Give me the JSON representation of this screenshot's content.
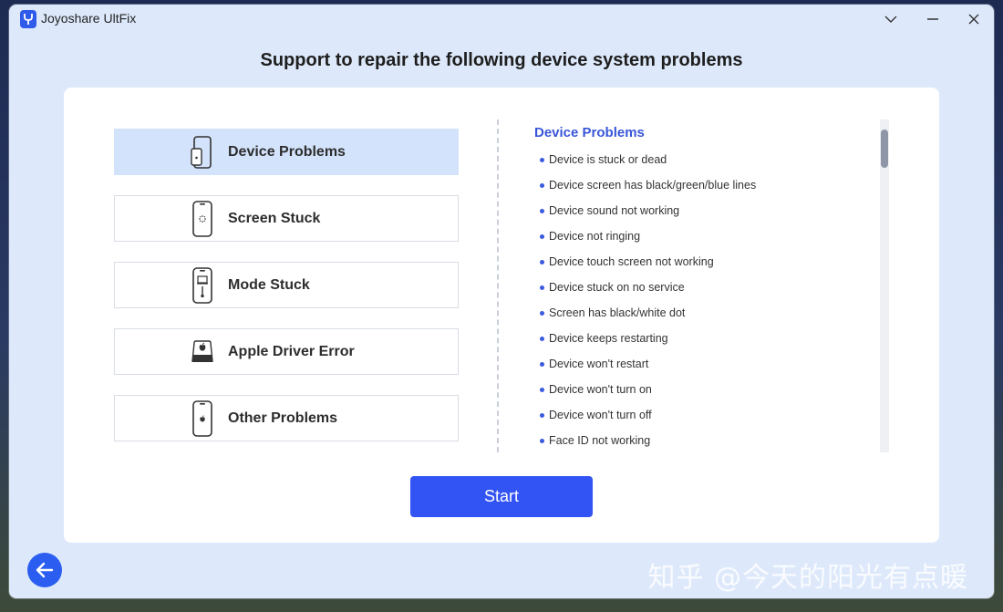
{
  "window": {
    "title": "Joyoshare UltFix",
    "controls": [
      "chevron-down-icon",
      "minimize-icon",
      "close-icon"
    ]
  },
  "heading": "Support to repair the following device system problems",
  "categories": [
    {
      "label": "Device Problems",
      "icon": "phone-side-icon",
      "active": true
    },
    {
      "label": "Screen Stuck",
      "icon": "phone-loading-icon",
      "active": false
    },
    {
      "label": "Mode Stuck",
      "icon": "phone-cable-icon",
      "active": false
    },
    {
      "label": "Apple Driver Error",
      "icon": "drive-apple-icon",
      "active": false
    },
    {
      "label": "Other Problems",
      "icon": "phone-apple-icon",
      "active": false
    }
  ],
  "problems": {
    "title": "Device Problems",
    "items": [
      "Device is stuck or dead",
      "Device screen has black/green/blue lines",
      "Device sound not working",
      "Device not ringing",
      "Device touch screen not working",
      "Device stuck on no service",
      "Screen has black/white dot",
      "Device keeps restarting",
      "Device won't restart",
      "Device won't turn on",
      "Device won't turn off",
      "Face ID not working"
    ]
  },
  "start_label": "Start",
  "back_icon": "arrow-left-icon",
  "watermark": "知乎 @今天的阳光有点暖",
  "colors": {
    "accent": "#3354f4",
    "active_category": "#d3e3fb",
    "problems_title": "#3856d8",
    "window_bg": "#dde9fb"
  }
}
